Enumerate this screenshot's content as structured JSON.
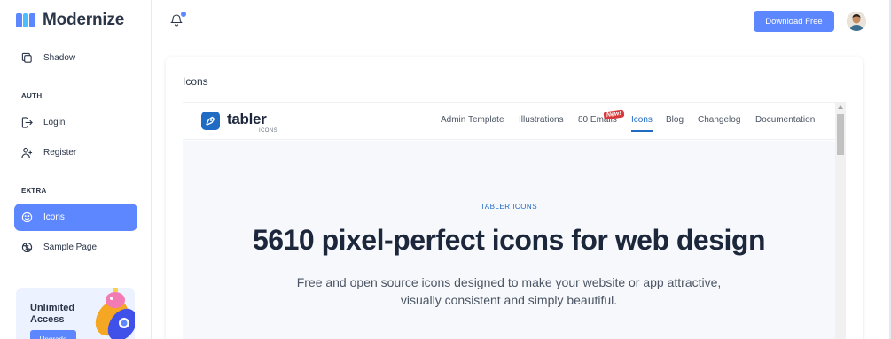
{
  "brand": {
    "name": "Modernize"
  },
  "sidebar": {
    "items": [
      {
        "label": "Shadow",
        "icon": "copy-icon"
      },
      {
        "label": "Login",
        "icon": "login-icon"
      },
      {
        "label": "Register",
        "icon": "user-plus-icon"
      },
      {
        "label": "Icons",
        "icon": "mood-happy-icon",
        "active": true
      },
      {
        "label": "Sample Page",
        "icon": "aperture-icon"
      }
    ],
    "captions": {
      "auth": "AUTH",
      "extra": "EXTRA"
    },
    "promo": {
      "title": "Unlimited Access",
      "button": "Upgrade"
    }
  },
  "header": {
    "download_label": "Download Free",
    "notification_icon": "bell-icon"
  },
  "card": {
    "title": "Icons"
  },
  "embedded": {
    "logo_word": "tabler",
    "logo_sub": "ICONS",
    "nav": [
      {
        "label": "Admin Template"
      },
      {
        "label": "Illustrations"
      },
      {
        "label": "80 Emails"
      },
      {
        "label": "Icons",
        "active": true
      },
      {
        "label": "Blog"
      },
      {
        "label": "Changelog"
      },
      {
        "label": "Documentation"
      }
    ],
    "new_badge": "New!",
    "hero": {
      "eyebrow": "TABLER ICONS",
      "title": "5610 pixel-perfect icons for web design",
      "description_line1": "Free and open source icons designed to make your website or app attractive,",
      "description_line2": "visually consistent and simply beautiful."
    }
  },
  "colors": {
    "primary": "#5d87ff",
    "tabler_blue": "#206bc4",
    "text": "#2a3547",
    "badge_red": "#d63939"
  }
}
